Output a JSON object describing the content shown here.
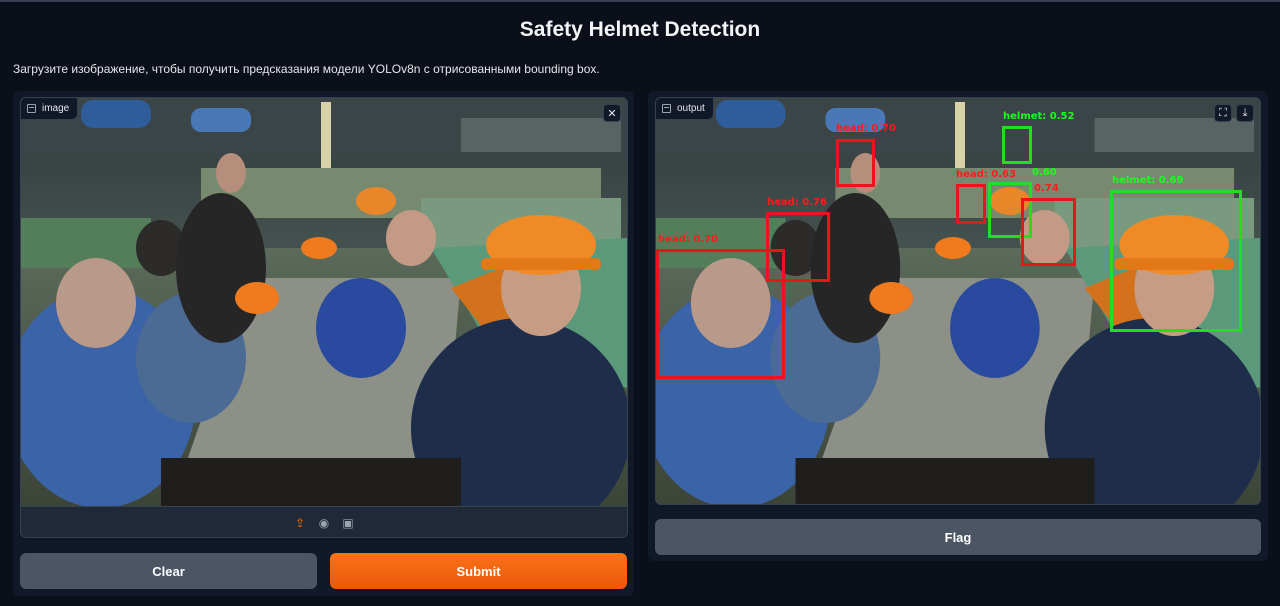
{
  "app": {
    "title": "Safety Helmet Detection",
    "description": "Загрузите изображение, чтобы получить предсказания модели YOLOv8n с отрисованными bounding box."
  },
  "input_panel": {
    "label": "image",
    "clear_icon": "close-icon",
    "sources": [
      "upload-icon",
      "webcam-icon",
      "clipboard-icon"
    ]
  },
  "output_panel": {
    "label": "output",
    "icons": [
      "fullscreen-icon",
      "download-icon"
    ]
  },
  "buttons": {
    "clear": "Clear",
    "submit": "Submit",
    "flag": "Flag"
  },
  "detections": [
    {
      "label": "head: 0.70",
      "class": "head"
    },
    {
      "label": "helmet: 0.52",
      "class": "helmet"
    },
    {
      "label": "head: 0.63",
      "class": "head"
    },
    {
      "label": "0.60",
      "class": "helmet"
    },
    {
      "label": "0.74",
      "class": "head"
    },
    {
      "label": "head: 0.76",
      "class": "head"
    },
    {
      "label": "helmet: 0.69",
      "class": "helmet"
    },
    {
      "label": "head: 0.70",
      "class": "head"
    }
  ],
  "colors": {
    "accent": "#f97316",
    "background": "#0b0f19",
    "head_box": "#e8161c",
    "helmet_box": "#22dd22"
  }
}
